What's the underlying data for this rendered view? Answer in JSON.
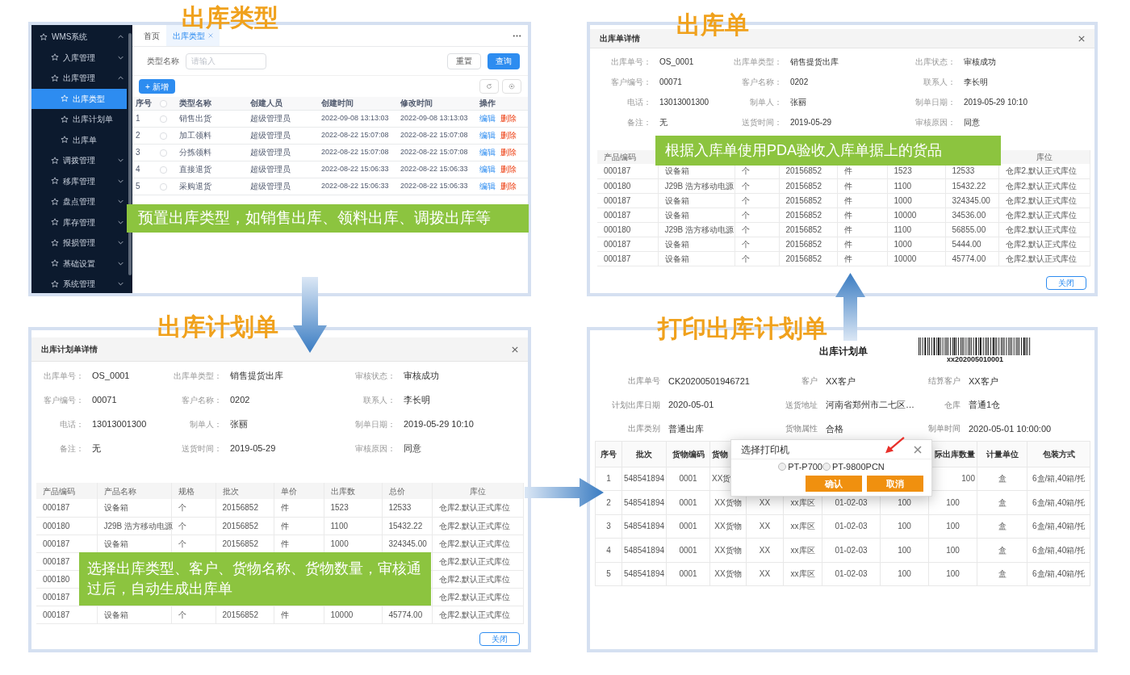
{
  "type_panel": {
    "heading": "出库类型",
    "sidebar": [
      {
        "label": "WMS系统",
        "expanded": true,
        "selected": false,
        "children": [
          {
            "label": "入库管理",
            "expanded": false,
            "selected": false
          },
          {
            "label": "出库管理",
            "expanded": true,
            "selected": false,
            "children": [
              {
                "label": "出库类型",
                "selected": true
              },
              {
                "label": "出库计划单",
                "selected": false
              },
              {
                "label": "出库单",
                "selected": false
              }
            ]
          },
          {
            "label": "调拨管理",
            "expanded": false,
            "selected": false
          },
          {
            "label": "移库管理",
            "expanded": false,
            "selected": false
          },
          {
            "label": "盘点管理",
            "expanded": false,
            "selected": false
          },
          {
            "label": "库存管理",
            "expanded": false,
            "selected": false
          },
          {
            "label": "报损管理",
            "expanded": false,
            "selected": false
          },
          {
            "label": "基础设置",
            "expanded": false,
            "selected": false
          },
          {
            "label": "系统管理",
            "expanded": false,
            "selected": false
          }
        ]
      }
    ],
    "tabs": [
      {
        "label": "首页",
        "selected": false,
        "closable": false
      },
      {
        "label": "出库类型",
        "selected": true,
        "closable": true
      }
    ],
    "filter": {
      "label": "类型名称",
      "placeholder": "请输入"
    },
    "reset": "重置",
    "query": "查询",
    "add": "+ 新增",
    "table": {
      "columns": [
        "序号",
        "类型名称",
        "创建人员",
        "创建时间",
        "修改时间",
        "操作"
      ],
      "select_all": false,
      "rows": [
        {
          "no": "1",
          "checked": false,
          "name": "销售出货",
          "creator": "超级管理员",
          "created": "2022-09-08 13:13:03",
          "modified": "2022-09-08 13:13:03",
          "edit": "编辑",
          "delete": "删除"
        },
        {
          "no": "2",
          "checked": false,
          "name": "加工领料",
          "creator": "超级管理员",
          "created": "2022-08-22 15:07:08",
          "modified": "2022-08-22 15:07:08",
          "edit": "编辑",
          "delete": "删除"
        },
        {
          "no": "3",
          "checked": false,
          "name": "分拣领料",
          "creator": "超级管理员",
          "created": "2022-08-22 15:07:08",
          "modified": "2022-08-22 15:07:08",
          "edit": "编辑",
          "delete": "删除"
        },
        {
          "no": "4",
          "checked": false,
          "name": "直接退货",
          "creator": "超级管理员",
          "created": "2022-08-22 15:06:33",
          "modified": "2022-08-22 15:06:33",
          "edit": "编辑",
          "delete": "删除"
        },
        {
          "no": "5",
          "checked": false,
          "name": "采购退货",
          "creator": "超级管理员",
          "created": "2022-08-22 15:06:33",
          "modified": "2022-08-22 15:06:33",
          "edit": "编辑",
          "delete": "删除"
        }
      ]
    },
    "callout": "预置出库类型，如销售出库、领料出库、调拨出库等"
  },
  "order_panel": {
    "heading": "出库单",
    "title": "出库单详情",
    "fields": [
      {
        "label": "出库单号：",
        "value": "OS_0001"
      },
      {
        "label": "出库单类型：",
        "value": "销售提货出库"
      },
      {
        "label": "出库状态：",
        "value": "审核成功"
      },
      {
        "label": "客户编号：",
        "value": "00071"
      },
      {
        "label": "客户名称：",
        "value": "0202"
      },
      {
        "label": "联系人：",
        "value": "李长明"
      },
      {
        "label": "电话：",
        "value": "13013001300"
      },
      {
        "label": "制单人：",
        "value": "张丽"
      },
      {
        "label": "制单日期：",
        "value": "2019-05-29 10:10"
      },
      {
        "label": "备注：",
        "value": "无"
      },
      {
        "label": "送货时间：",
        "value": "2019-05-29"
      },
      {
        "label": "审核原因：",
        "value": "同意"
      }
    ],
    "table": {
      "columns": [
        "产品编码",
        null,
        null,
        null,
        null,
        null,
        null,
        "库位"
      ],
      "rows": [
        [
          "000187",
          "设备箱",
          "个",
          "20156852",
          "件",
          "1523",
          "12533",
          "仓库2.默认正式库位"
        ],
        [
          "000180",
          "J29B 浩方移动电源",
          "个",
          "20156852",
          "件",
          "1100",
          "15432.22",
          "仓库2.默认正式库位"
        ],
        [
          "000187",
          "设备箱",
          "个",
          "20156852",
          "件",
          "1000",
          "324345.00",
          "仓库2.默认正式库位"
        ],
        [
          "000187",
          "设备箱",
          "个",
          "20156852",
          "件",
          "10000",
          "34536.00",
          "仓库2.默认正式库位"
        ],
        [
          "000180",
          "J29B 浩方移动电源",
          "个",
          "20156852",
          "件",
          "1100",
          "56855.00",
          "仓库2.默认正式库位"
        ],
        [
          "000187",
          "设备箱",
          "个",
          "20156852",
          "件",
          "1000",
          "5444.00",
          "仓库2.默认正式库位"
        ],
        [
          "000187",
          "设备箱",
          "个",
          "20156852",
          "件",
          "10000",
          "45774.00",
          "仓库2.默认正式库位"
        ]
      ]
    },
    "close_button": "关闭",
    "callout": "根据入库单使用PDA验收入库单据上的货品"
  },
  "plan_panel": {
    "heading": "出库计划单",
    "title": "出库计划单详情",
    "fields": [
      {
        "label": "出库单号：",
        "value": "OS_0001"
      },
      {
        "label": "出库单类型：",
        "value": "销售提货出库"
      },
      {
        "label": "审核状态：",
        "value": "审核成功"
      },
      {
        "label": "客户编号：",
        "value": "00071"
      },
      {
        "label": "客户名称：",
        "value": "0202"
      },
      {
        "label": "联系人：",
        "value": "李长明"
      },
      {
        "label": "电话：",
        "value": "13013001300"
      },
      {
        "label": "制单人：",
        "value": "张丽"
      },
      {
        "label": "制单日期：",
        "value": "2019-05-29 10:10"
      },
      {
        "label": "备注：",
        "value": "无"
      },
      {
        "label": "送货时间：",
        "value": "2019-05-29"
      },
      {
        "label": "审核原因：",
        "value": "同意"
      }
    ],
    "table": {
      "columns": [
        "产品编码",
        "产品名称",
        "规格",
        "批次",
        "单价",
        "出库数",
        "总价",
        "库位"
      ],
      "rows": [
        [
          "000187",
          "设备箱",
          "个",
          "20156852",
          "件",
          "1523",
          "12533",
          "仓库2.默认正式库位"
        ],
        [
          "000180",
          "J29B 浩方移动电源",
          "个",
          "20156852",
          "件",
          "1100",
          "15432.22",
          "仓库2.默认正式库位"
        ],
        [
          "000187",
          "设备箱",
          "个",
          "20156852",
          "件",
          "1000",
          "324345.00",
          "仓库2.默认正式库位"
        ],
        [
          "000187",
          null,
          null,
          null,
          null,
          null,
          null,
          "仓库2.默认正式库位"
        ],
        [
          "000180",
          null,
          null,
          null,
          null,
          null,
          null,
          "仓库2.默认正式库位"
        ],
        [
          "000187",
          null,
          null,
          null,
          null,
          null,
          null,
          "仓库2.默认正式库位"
        ],
        [
          "000187",
          "设备箱",
          "个",
          "20156852",
          "件",
          "10000",
          "45774.00",
          "仓库2.默认正式库位"
        ]
      ]
    },
    "close_button": "关闭",
    "callout": "选择出库类型、客户、货物名称、货物数量，审核通过后，自动生成出库单"
  },
  "print_panel": {
    "heading": "打印出库计划单",
    "doc_title": "出库计划单",
    "barcode": "xx202005010001",
    "fields": [
      {
        "label": "出库单号",
        "value": "CK20200501946721"
      },
      {
        "label": "客户",
        "value": "XX客户"
      },
      {
        "label": "结算客户",
        "value": "XX客户"
      },
      {
        "label": "计划出库日期",
        "value": "2020-05-01"
      },
      {
        "label": "送货地址",
        "value": "河南省郑州市二七区…"
      },
      {
        "label": "仓库",
        "value": "普通1仓"
      },
      {
        "label": "出库类别",
        "value": "普通出库"
      },
      {
        "label": "货物属性",
        "value": "合格"
      },
      {
        "label": "制单时间",
        "value": "2020-05-01 10:00:00"
      }
    ],
    "table": {
      "columns": [
        "序号",
        "批次",
        "货物编码",
        "货物",
        null,
        null,
        null,
        null,
        "际出库数量",
        "计量单位",
        "包装方式"
      ],
      "rows": [
        [
          "1",
          "548541894",
          "0001",
          "XX货",
          null,
          null,
          null,
          null,
          "100",
          "盒",
          "6盒/箱,40箱/托"
        ],
        [
          "2",
          "548541894",
          "0001",
          "XX货物",
          "XX",
          "xx库区",
          "01-02-03",
          "100",
          "100",
          "盒",
          "6盒/箱,40箱/托"
        ],
        [
          "3",
          "548541894",
          "0001",
          "XX货物",
          "XX",
          "xx库区",
          "01-02-03",
          "100",
          "100",
          "盒",
          "6盒/箱,40箱/托"
        ],
        [
          "4",
          "548541894",
          "0001",
          "XX货物",
          "XX",
          "xx库区",
          "01-02-03",
          "100",
          "100",
          "盒",
          "6盒/箱,40箱/托"
        ],
        [
          "5",
          "548541894",
          "0001",
          "XX货物",
          "XX",
          "xx库区",
          "01-02-03",
          "100",
          "100",
          "盒",
          "6盒/箱,40箱/托"
        ]
      ]
    },
    "dialog": {
      "title": "选择打印机",
      "printers": [
        {
          "label": "PT-P700",
          "selected": false
        },
        {
          "label": "PT-9800PCN",
          "selected": false
        }
      ],
      "confirm": "确认",
      "cancel": "取消"
    }
  }
}
